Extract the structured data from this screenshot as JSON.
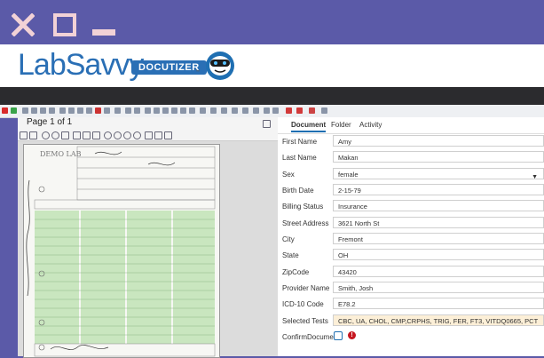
{
  "window": {
    "close_icon": "close-x-icon",
    "maximize_icon": "maximize-square-icon",
    "minimize_icon": "minimize-dash-icon",
    "chrome_color": "#5b5aa8",
    "icon_color": "#f2d2d6"
  },
  "brand": {
    "name_part1": "Lab",
    "name_part2": "Savvy",
    "product": "DOCUTIZER",
    "trademark": "™",
    "accent": "#2a6fb5"
  },
  "viewer": {
    "page_label": "Page 1 of 1",
    "doc_title": "DEMO LAB"
  },
  "tabs": [
    {
      "label": "Document"
    },
    {
      "label": "Folder"
    },
    {
      "label": "Activity"
    }
  ],
  "fields": {
    "first_name": {
      "label": "First Name",
      "value": "Amy"
    },
    "last_name": {
      "label": "Last Name",
      "value": "Makan"
    },
    "sex": {
      "label": "Sex",
      "value": "female"
    },
    "birth_date": {
      "label": "Birth Date",
      "value": "2-15-79"
    },
    "billing_status": {
      "label": "Billing Status",
      "value": "Insurance"
    },
    "street_address": {
      "label": "Street Address",
      "value": "3621 North St"
    },
    "city": {
      "label": "City",
      "value": "Fremont"
    },
    "state": {
      "label": "State",
      "value": "OH"
    },
    "zipcode": {
      "label": "ZipCode",
      "value": "43420"
    },
    "provider_name": {
      "label": "Provider Name",
      "value": "Smith, Josh"
    },
    "icd10_code": {
      "label": "ICD-10 Code",
      "value": "E78.2"
    },
    "selected_tests": {
      "label": "Selected Tests",
      "value": "CBC, UA, CHOL, CMP,CRPHS, TRIG, FER, FT3, VITDQ0665, PCT"
    },
    "confirm_document": {
      "label": "ConfirmDocument"
    }
  }
}
